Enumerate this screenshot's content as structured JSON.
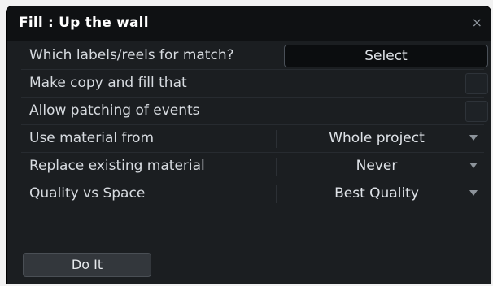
{
  "dialog": {
    "title": "Fill : Up the wall",
    "close_symbol": "×",
    "close_icon": "close-icon"
  },
  "rows": [
    {
      "label": "Which labels/reels for match?",
      "control": "button",
      "value": "Select"
    },
    {
      "label": "Make copy and fill that",
      "control": "checkbox",
      "checked": false
    },
    {
      "label": "Allow patching of events",
      "control": "checkbox",
      "checked": false
    },
    {
      "label": "Use material from",
      "control": "dropdown",
      "value": "Whole project",
      "icon": "chevron-down-icon"
    },
    {
      "label": "Replace existing material",
      "control": "dropdown",
      "value": "Never",
      "icon": "chevron-down-icon"
    },
    {
      "label": "Quality vs Space",
      "control": "dropdown",
      "value": "Best Quality",
      "icon": "chevron-down-icon"
    }
  ],
  "actions": {
    "do_it_label": "Do It"
  },
  "colors": {
    "dialog_bg": "#1b1e21",
    "titlebar_bg": "#0f1113",
    "text": "#d7dbe0"
  }
}
